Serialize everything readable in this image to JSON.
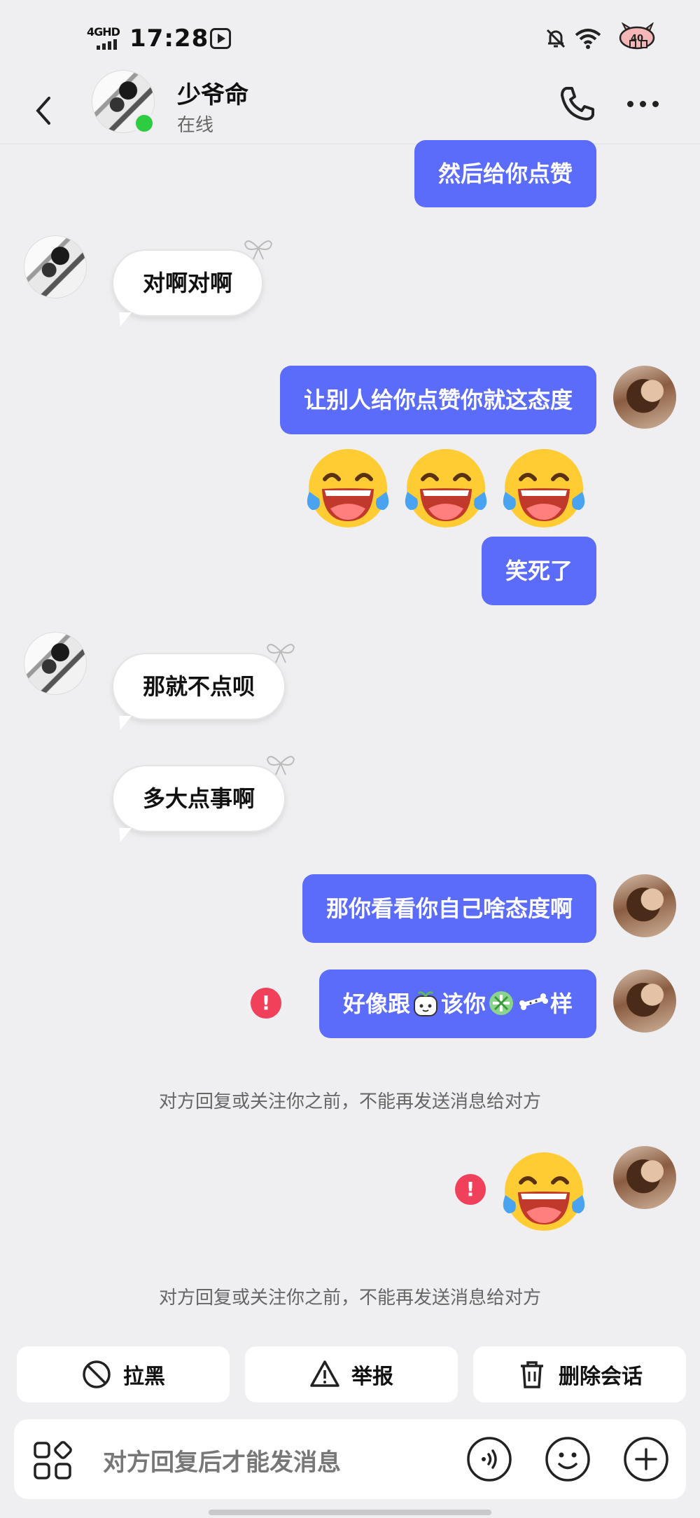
{
  "status_bar": {
    "network": "4GHD",
    "time": "17:28",
    "battery_level": "40"
  },
  "header": {
    "contact_name": "少爷命",
    "contact_status": "在线"
  },
  "messages": {
    "m1": "然后给你点赞",
    "m2": "对啊对啊",
    "m3": "让别人给你点赞你就这态度",
    "m4": "笑死了",
    "m5": "那就不点呗",
    "m6": "多大点事啊",
    "m7": "那你看看你自己啥态度啊",
    "m8_part1": "好像跟",
    "m8_part2": "该你",
    "m8_part3": "样"
  },
  "error_mark": "!",
  "notices": {
    "n1": "对方回复或关注你之前，不能再发送消息给对方",
    "n2": "对方回复或关注你之前，不能再发送消息给对方"
  },
  "actions": {
    "block": "拉黑",
    "report": "举报",
    "delete": "删除会话"
  },
  "input": {
    "placeholder": "对方回复后才能发消息"
  },
  "colors": {
    "my_bubble": "#5b6bfa",
    "background": "#efeff1",
    "error": "#f1405a",
    "online": "#2ecc40"
  },
  "icons": [
    "back-arrow-icon",
    "phone-icon",
    "more-icon",
    "laughing-crying-emoji",
    "ban-icon",
    "warning-icon",
    "trash-icon",
    "apps-grid-icon",
    "voice-icon",
    "smiley-icon",
    "plus-icon"
  ]
}
